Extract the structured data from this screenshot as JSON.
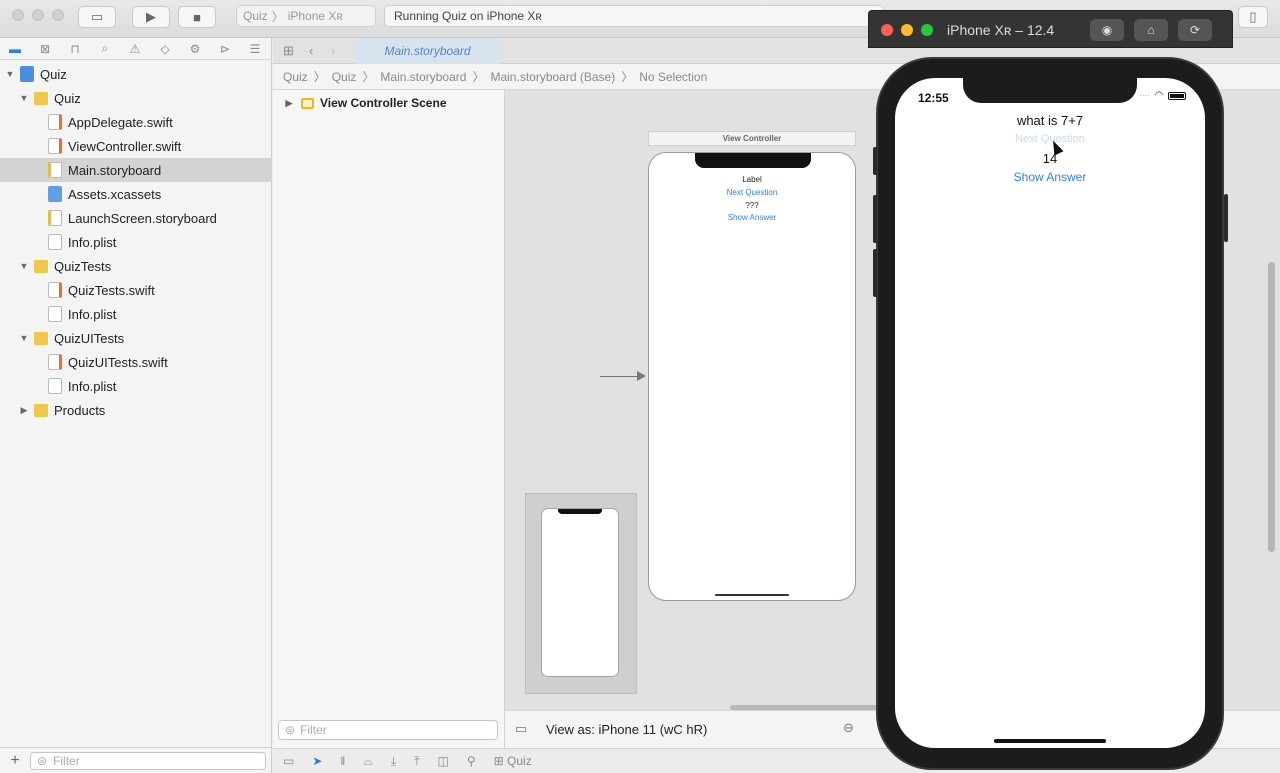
{
  "toolbar": {
    "scheme_project": "Quiz",
    "scheme_device": "iPhone Xʀ",
    "activity_text": "Running Quiz on iPhone Xʀ"
  },
  "navigator": {
    "tree": [
      {
        "label": "Quiz",
        "kind": "proj",
        "indent": 0,
        "expanded": true
      },
      {
        "label": "Quiz",
        "kind": "folder",
        "indent": 1,
        "expanded": true
      },
      {
        "label": "AppDelegate.swift",
        "kind": "swift",
        "indent": 2
      },
      {
        "label": "ViewController.swift",
        "kind": "swift",
        "indent": 2
      },
      {
        "label": "Main.storyboard",
        "kind": "sb",
        "indent": 2,
        "selected": true
      },
      {
        "label": "Assets.xcassets",
        "kind": "assets",
        "indent": 2
      },
      {
        "label": "LaunchScreen.storyboard",
        "kind": "sb",
        "indent": 2
      },
      {
        "label": "Info.plist",
        "kind": "plist",
        "indent": 2
      },
      {
        "label": "QuizTests",
        "kind": "folder",
        "indent": 1,
        "expanded": true
      },
      {
        "label": "QuizTests.swift",
        "kind": "swift",
        "indent": 2
      },
      {
        "label": "Info.plist",
        "kind": "plist",
        "indent": 2
      },
      {
        "label": "QuizUITests",
        "kind": "folder",
        "indent": 1,
        "expanded": true
      },
      {
        "label": "QuizUITests.swift",
        "kind": "swift",
        "indent": 2
      },
      {
        "label": "Info.plist",
        "kind": "plist",
        "indent": 2
      },
      {
        "label": "Products",
        "kind": "folder",
        "indent": 1,
        "expanded": false
      }
    ],
    "filter_placeholder": "Filter"
  },
  "editor": {
    "tab_label": "Main.storyboard",
    "jumpbar": [
      "Quiz",
      "Quiz",
      "Main.storyboard",
      "Main.storyboard (Base)",
      "No Selection"
    ],
    "outline_scene": "View Controller Scene",
    "outline_filter_placeholder": "Filter",
    "view_as": "View as: iPhone 11 (wC hR)"
  },
  "storyboard": {
    "vc_title": "View Controller",
    "question_label": "Label",
    "next_button": "Next Question",
    "answer_label": "???",
    "show_button": "Show Answer"
  },
  "debugbar": {
    "target": "Quiz"
  },
  "simulator": {
    "title": "iPhone Xʀ – 12.4",
    "time": "12:55",
    "question": "what is 7+7",
    "next_button": "Next Question",
    "answer": "14",
    "show_button": "Show Answer"
  },
  "colors": {
    "accent": "#2b7de9",
    "button_blue": "#2f7ff2"
  }
}
